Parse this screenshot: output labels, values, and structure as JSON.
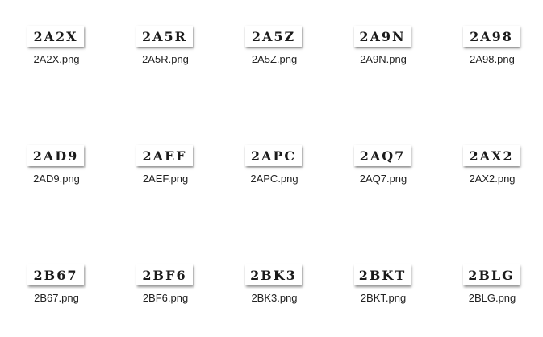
{
  "files": [
    {
      "captcha": "2A2X",
      "name": "2A2X.png"
    },
    {
      "captcha": "2A5R",
      "name": "2A5R.png"
    },
    {
      "captcha": "2A5Z",
      "name": "2A5Z.png"
    },
    {
      "captcha": "2A9N",
      "name": "2A9N.png"
    },
    {
      "captcha": "2A98",
      "name": "2A98.png"
    },
    {
      "captcha": "2AD9",
      "name": "2AD9.png"
    },
    {
      "captcha": "2AEF",
      "name": "2AEF.png"
    },
    {
      "captcha": "2APC",
      "name": "2APC.png"
    },
    {
      "captcha": "2AQ7",
      "name": "2AQ7.png"
    },
    {
      "captcha": "2AX2",
      "name": "2AX2.png"
    },
    {
      "captcha": "2B67",
      "name": "2B67.png"
    },
    {
      "captcha": "2BF6",
      "name": "2BF6.png"
    },
    {
      "captcha": "2BK3",
      "name": "2BK3.png"
    },
    {
      "captcha": "2BKT",
      "name": "2BKT.png"
    },
    {
      "captcha": "2BLG",
      "name": "2BLG.png"
    }
  ]
}
